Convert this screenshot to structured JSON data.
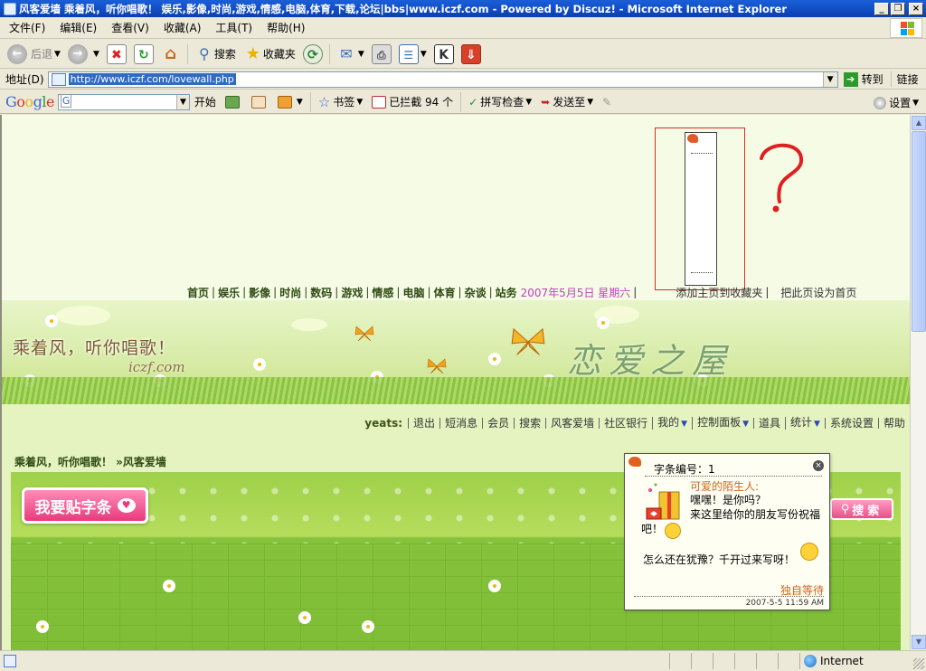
{
  "window": {
    "title": "风客爱墙 乘着风，听你唱歌！ 娱乐,影像,时尚,游戏,情感,电脑,体育,下载,论坛|bbs|www.iczf.com - Powered by Discuz! - Microsoft Internet Explorer",
    "minimize": "_",
    "maximize": "❐",
    "close": "×"
  },
  "menu": [
    "文件(F)",
    "编辑(E)",
    "查看(V)",
    "收藏(A)",
    "工具(T)",
    "帮助(H)"
  ],
  "toolbar": {
    "back": "后退",
    "search": "搜索",
    "favorites": "收藏夹"
  },
  "address": {
    "label": "地址(D)",
    "url": "http://www.iczf.com/lovewall.php",
    "go": "转到",
    "links": "链接"
  },
  "google_bar": {
    "logo": "Google",
    "search_value": "G",
    "start": "开始",
    "bookmarks": "书签",
    "blocked": "已拦截 94 个",
    "spellcheck": "拼写检查",
    "send_to": "发送至",
    "settings": "设置"
  },
  "site_nav": {
    "items": [
      "首页",
      "娱乐",
      "影像",
      "时尚",
      "数码",
      "游戏",
      "情感",
      "电脑",
      "体育",
      "杂谈",
      "站务"
    ],
    "date": "2007年5月5日 星期六",
    "add_favorite": "添加主页到收藏夹",
    "set_home": "把此页设为首页"
  },
  "banner": {
    "slogan": "乘着风，听你唱歌！",
    "site": "iczf.com",
    "calligraphy": "恋爱之屋"
  },
  "annotation": {
    "question_mark": "?"
  },
  "user_nav": {
    "username": "yeats:",
    "items": [
      {
        "label": "退出",
        "dropdown": false
      },
      {
        "label": "短消息",
        "dropdown": false
      },
      {
        "label": "会员",
        "dropdown": false
      },
      {
        "label": "搜索",
        "dropdown": false
      },
      {
        "label": "风客爱墙",
        "dropdown": false
      },
      {
        "label": "社区银行",
        "dropdown": false
      },
      {
        "label": "我的",
        "dropdown": true
      },
      {
        "label": "控制面板",
        "dropdown": true
      },
      {
        "label": "道具",
        "dropdown": false
      },
      {
        "label": "统计",
        "dropdown": true
      },
      {
        "label": "系统设置",
        "dropdown": false
      },
      {
        "label": "帮助",
        "dropdown": false
      }
    ]
  },
  "breadcrumb": "乘着风，听你唱歌！ »风客爱墙",
  "wall": {
    "post_button": "我要贴字条",
    "search_button": "搜索"
  },
  "note": {
    "header": "字条编号：1",
    "from": "可爱的陌生人:",
    "body_line1": "嘿嘿！是你吗？",
    "body_line2": "来这里给你的朋友写份祝福",
    "body_line3": "吧！",
    "body_line4": "怎么还在犹豫？千开过来写呀！",
    "signature": "独自等待",
    "time": "2007-5-5 11:59 AM"
  },
  "status": {
    "zone": "Internet"
  },
  "colors": {
    "title_bar": "#0a3fb0",
    "page_bg": "#f5fbe4",
    "wall_green": "#9fd14a",
    "post_pink": "#e83a7c",
    "annotation_red": "#d92c2c"
  }
}
